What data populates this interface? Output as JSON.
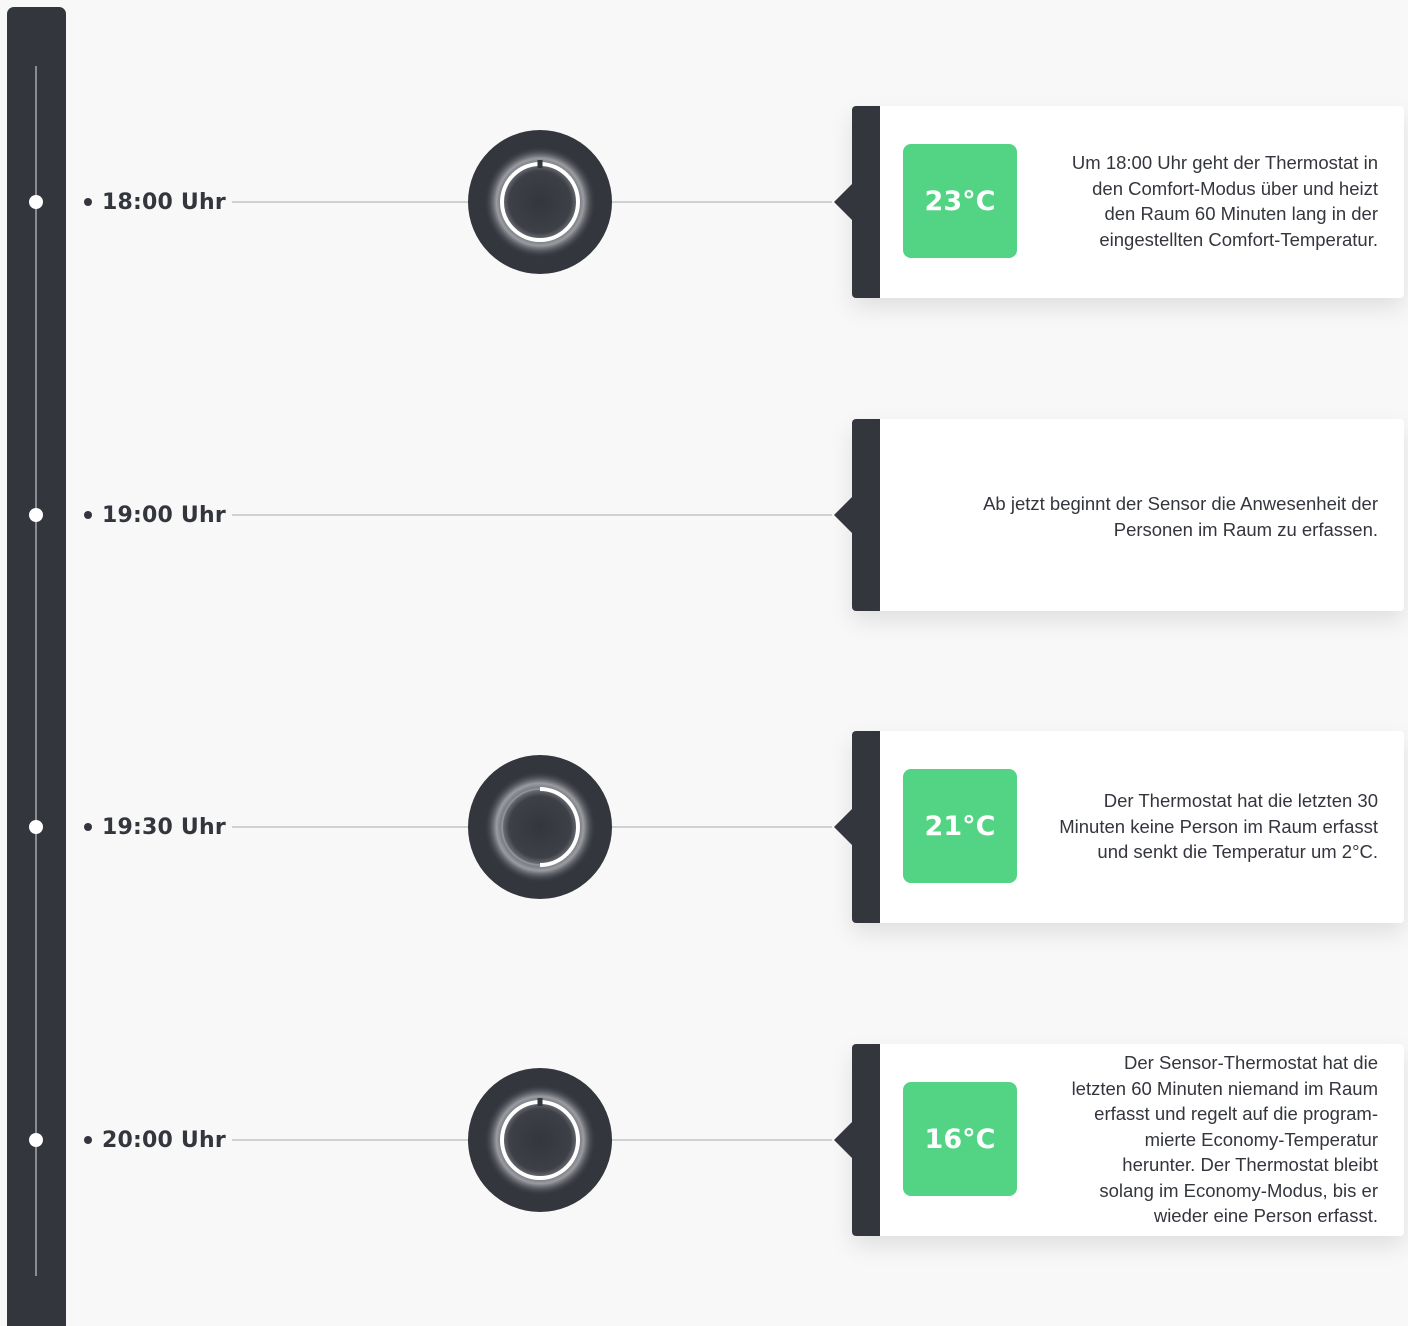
{
  "colors": {
    "dark": "#34363d",
    "accent_green": "#52d484",
    "card_bg": "#ffffff",
    "page_bg": "#f8f8f8"
  },
  "timeline": [
    {
      "time": "18:00 Uhr",
      "knob_icon": "thermostat-ring-icon",
      "temperature": "23°C",
      "text": "Um 18:00 Uhr geht der Thermostat in\nden Comfort-Modus über und heizt\nden Raum 60 Minuten lang in der\neingestellten Comfort-Temperatur."
    },
    {
      "time": "19:00 Uhr",
      "temperature": "",
      "text": "Ab jetzt beginnt der Sensor die Anwesenheit der\nPersonen im Raum zu erfassen."
    },
    {
      "time": "19:30 Uhr",
      "knob_icon": "thermostat-half-ring-icon",
      "temperature": "21°C",
      "text": "Der Thermostat hat die letzten 30\nMinuten keine Person im Raum erfasst\nund senkt die Temperatur um 2°C."
    },
    {
      "time": "20:00 Uhr",
      "knob_icon": "thermostat-ring-icon",
      "temperature": "16°C",
      "text": "Der Sensor-Thermostat hat die\nletzten 60 Minuten niemand im Raum\nerfasst und regelt auf die program-\nmierte Economy-Temperatur\nherunter. Der Thermostat bleibt\nsolang im Economy-Modus, bis er\nwieder eine Person erfasst."
    }
  ]
}
